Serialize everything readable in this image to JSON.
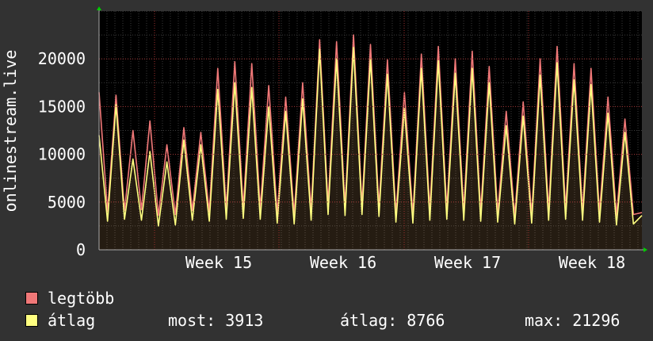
{
  "chart_data": {
    "type": "area",
    "ylabel": "onlinestream.live",
    "ylim": [
      0,
      25000
    ],
    "yticks": [
      0,
      5000,
      10000,
      15000,
      20000
    ],
    "ytick_labels": [
      "0",
      "5000",
      "10000",
      "15000",
      "20000"
    ],
    "xtick_labels": [
      "Week 15",
      "Week 16",
      "Week 17",
      "Week 18"
    ],
    "grid": true,
    "series": [
      {
        "name": "legtöbb",
        "color": "#f07878",
        "values": [
          16500,
          4000,
          16200,
          4100,
          12500,
          4200,
          13500,
          3600,
          11000,
          3700,
          12800,
          4100,
          12300,
          4000,
          19000,
          4300,
          19700,
          4400,
          19500,
          4300,
          17200,
          3800,
          16000,
          3700,
          17500,
          4200,
          22000,
          4800,
          21800,
          4600,
          22500,
          4700,
          21500,
          4500,
          19900,
          3800,
          16500,
          3700,
          20500,
          4200,
          21300,
          4300,
          20000,
          4200,
          20800,
          4000,
          19200,
          3900,
          14500,
          3600,
          15500,
          3700,
          20000,
          4200,
          21300,
          4300,
          19500,
          4100,
          19000,
          3900,
          16000,
          3600,
          13700,
          3700,
          3900
        ]
      },
      {
        "name": "átlag",
        "color": "#ffff80",
        "values": [
          12000,
          3000,
          15200,
          3200,
          9500,
          3100,
          10300,
          2500,
          9200,
          2600,
          11500,
          3100,
          11000,
          3000,
          16800,
          3200,
          17500,
          3300,
          17000,
          3200,
          15000,
          2800,
          14500,
          2700,
          15800,
          3100,
          21000,
          3700,
          20000,
          3600,
          21200,
          3700,
          20000,
          3500,
          18400,
          2900,
          14800,
          2800,
          19000,
          3100,
          19800,
          3200,
          18500,
          3100,
          19000,
          3000,
          17500,
          2900,
          13000,
          2700,
          14000,
          2800,
          18300,
          3100,
          19600,
          3200,
          17800,
          3100,
          17300,
          2900,
          14300,
          2600,
          12300,
          2700,
          3600
        ]
      }
    ]
  },
  "legend": {
    "max_label": "legtöbb",
    "avg_label": "átlag",
    "stat_now": "most: 3913",
    "stat_avg": "átlag: 8766",
    "stat_max": "max: 21296"
  }
}
